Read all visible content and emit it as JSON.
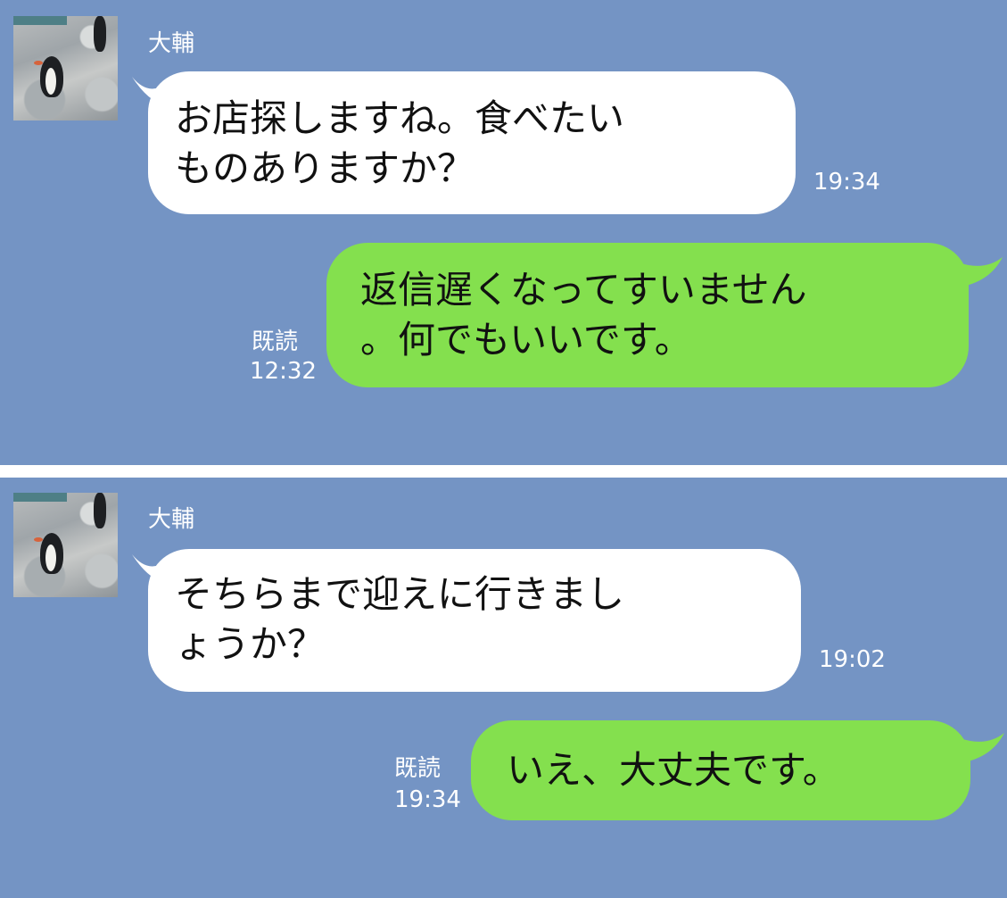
{
  "panels": [
    {
      "contact_name": "大輔",
      "incoming": {
        "lines": [
          "お店探しますね。食べたい",
          "ものありますか？"
        ],
        "time": "19:34"
      },
      "outgoing": {
        "lines": [
          "返信遅くなってすいません",
          "。何でもいいです。"
        ],
        "read_label": "既読",
        "time": "12:32"
      }
    },
    {
      "contact_name": "大輔",
      "incoming": {
        "lines": [
          "そちらまで迎えに行きまし",
          "ょうか？"
        ],
        "time": "19:02"
      },
      "outgoing": {
        "lines": [
          "いえ、大丈夫です。"
        ],
        "read_label": "既読",
        "time": "19:34"
      }
    }
  ],
  "colors": {
    "background": "#7494c4",
    "incoming_bubble": "#ffffff",
    "outgoing_bubble": "#84e04e"
  },
  "icons": [
    "avatar-penguin",
    "bubble-tail"
  ]
}
